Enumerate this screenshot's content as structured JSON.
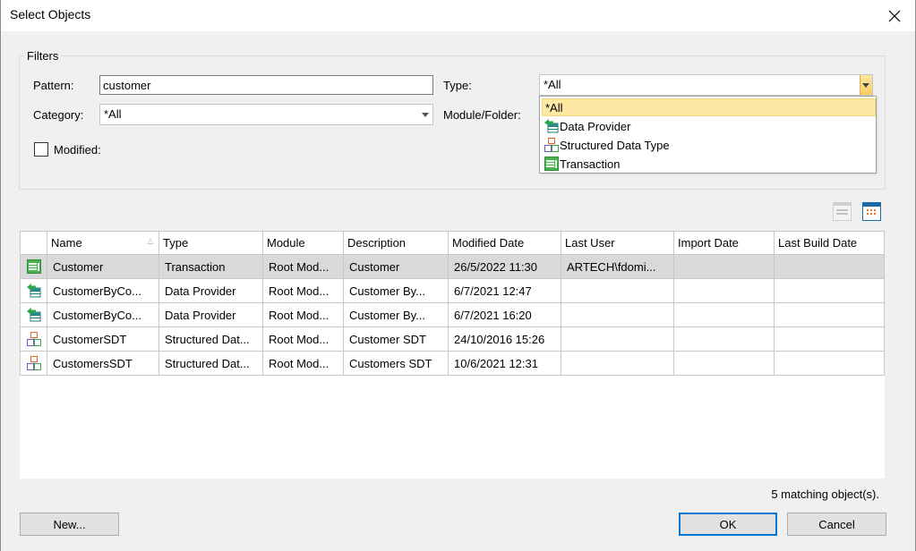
{
  "window": {
    "title": "Select Objects",
    "close_icon": "close-icon"
  },
  "filters": {
    "legend": "Filters",
    "pattern_label": "Pattern:",
    "pattern_value": "customer",
    "category_label": "Category:",
    "category_value": "*All",
    "modified_label": "Modified:",
    "modified_checked": false,
    "type_label": "Type:",
    "type_value": "*All",
    "module_label": "Module/Folder:",
    "type_dropdown": {
      "options": [
        {
          "label": "*All",
          "icon": "none",
          "selected": true
        },
        {
          "label": "Data Provider",
          "icon": "data-provider-icon",
          "selected": false
        },
        {
          "label": "Structured Data Type",
          "icon": "sdt-icon",
          "selected": false
        },
        {
          "label": "Transaction",
          "icon": "transaction-icon",
          "selected": false
        }
      ]
    }
  },
  "view_toggles": [
    {
      "name": "list-view-icon",
      "active": false
    },
    {
      "name": "details-view-icon",
      "active": true
    }
  ],
  "table": {
    "columns": [
      "",
      "Name",
      "Type",
      "Module",
      "Description",
      "Modified Date",
      "Last User",
      "Import Date",
      "Last Build Date"
    ],
    "sort_column": "Name",
    "rows": [
      {
        "icon": "transaction-icon",
        "name": "Customer",
        "type": "Transaction",
        "module": "Root Mod...",
        "description": "Customer",
        "modified": "26/5/2022 11:30",
        "user": "ARTECH\\fdomi...",
        "import": "",
        "build": "",
        "selected": true
      },
      {
        "icon": "data-provider-icon",
        "name": "CustomerByCo...",
        "type": "Data Provider",
        "module": "Root Mod...",
        "description": "Customer By...",
        "modified": "6/7/2021 12:47",
        "user": "",
        "import": "",
        "build": "",
        "selected": false
      },
      {
        "icon": "data-provider-icon",
        "name": "CustomerByCo...",
        "type": "Data Provider",
        "module": "Root Mod...",
        "description": "Customer By...",
        "modified": "6/7/2021 16:20",
        "user": "",
        "import": "",
        "build": "",
        "selected": false
      },
      {
        "icon": "sdt-icon",
        "name": "CustomerSDT",
        "type": "Structured Dat...",
        "module": "Root Mod...",
        "description": "Customer SDT",
        "modified": "24/10/2016 15:26",
        "user": "",
        "import": "",
        "build": "",
        "selected": false
      },
      {
        "icon": "sdt-icon",
        "name": "CustomersSDT",
        "type": "Structured Dat...",
        "module": "Root Mod...",
        "description": "Customers SDT",
        "modified": "10/6/2021 12:31",
        "user": "",
        "import": "",
        "build": "",
        "selected": false
      }
    ]
  },
  "status": "5 matching object(s).",
  "buttons": {
    "new": "New...",
    "ok": "OK",
    "cancel": "Cancel"
  },
  "colors": {
    "accent": "#0078d7",
    "selection_row": "#d9d9d9",
    "dropdown_highlight": "#fde8a4"
  }
}
